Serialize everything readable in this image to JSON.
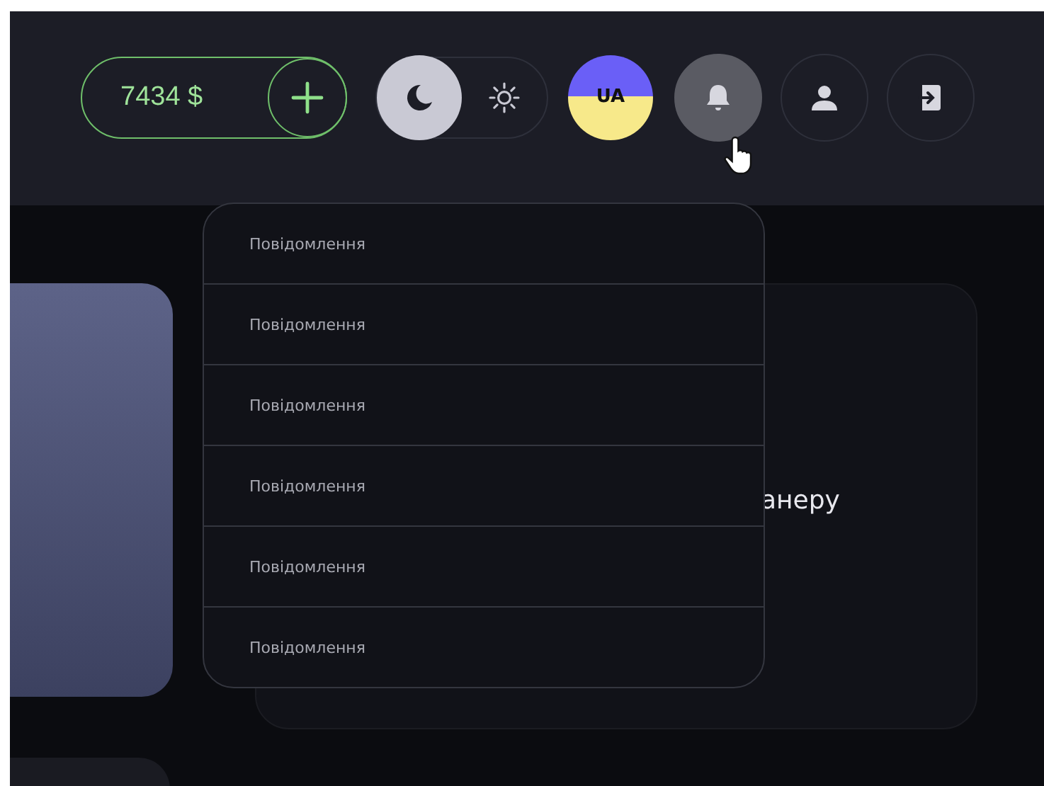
{
  "header": {
    "balance": "7434 $",
    "theme_options": [
      {
        "kind": "dark",
        "selected": true
      },
      {
        "kind": "light",
        "selected": false
      }
    ],
    "language": "UA",
    "notifications_button": {
      "active": true
    }
  },
  "notifications": [
    {
      "text": "Повідомлення"
    },
    {
      "text": "Повідомлення"
    },
    {
      "text": "Повідомлення"
    },
    {
      "text": "Повідомлення"
    },
    {
      "text": "Повідомлення"
    },
    {
      "text": "Повідомлення"
    }
  ],
  "banner_card": {
    "text": "анеру"
  }
}
